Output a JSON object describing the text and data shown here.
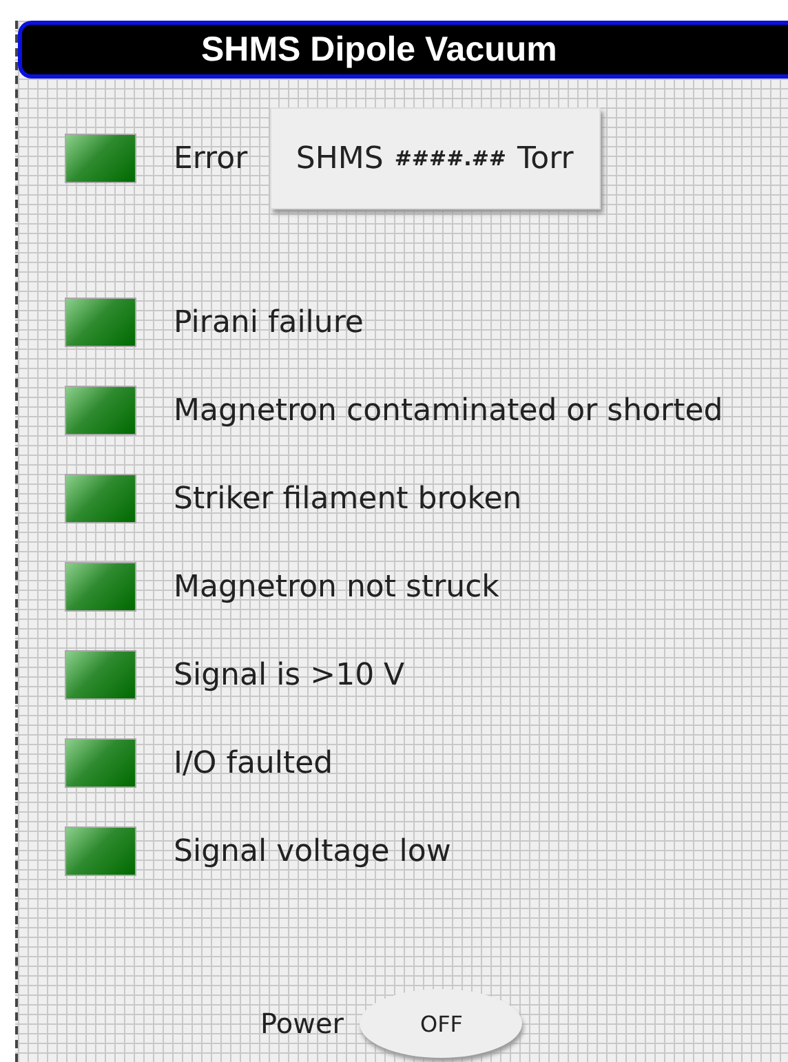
{
  "panel": {
    "title": "SHMS Dipole Vacuum"
  },
  "error": {
    "label": "Error",
    "on": false
  },
  "readout": {
    "prefix": "SHMS",
    "value": "####.##",
    "unit": "Torr"
  },
  "indicators": [
    {
      "label": "Pirani failure",
      "on": false
    },
    {
      "label": "Magnetron contaminated or shorted",
      "on": false
    },
    {
      "label": "Striker filament broken",
      "on": false
    },
    {
      "label": "Magnetron not struck",
      "on": false
    },
    {
      "label": "Signal is >10 V",
      "on": false
    },
    {
      "label": "I/O faulted",
      "on": false
    },
    {
      "label": "Signal voltage low",
      "on": false
    }
  ],
  "power": {
    "label": "Power",
    "text": "OFF",
    "on": false
  }
}
